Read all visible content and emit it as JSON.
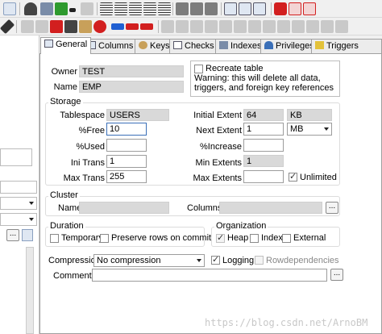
{
  "tabs": [
    {
      "label": "General",
      "icon": "general-tab-icon"
    },
    {
      "label": "Columns",
      "icon": "columns-tab-icon"
    },
    {
      "label": "Keys",
      "icon": "keys-tab-icon"
    },
    {
      "label": "Checks",
      "icon": "checks-tab-icon"
    },
    {
      "label": "Indexes",
      "icon": "indexes-tab-icon"
    },
    {
      "label": "Privileges",
      "icon": "privileges-tab-icon"
    },
    {
      "label": "Triggers",
      "icon": "triggers-tab-icon"
    }
  ],
  "general": {
    "owner_label": "Owner",
    "owner_value": "TEST",
    "name_label": "Name",
    "name_value": "EMP",
    "recreate_label": "Recreate table",
    "recreate_checked": false,
    "warning": "Warning: this will delete all data, triggers, and foreign key references"
  },
  "storage": {
    "title": "Storage",
    "tablespace_label": "Tablespace",
    "tablespace_value": "USERS",
    "pctfree_label": "%Free",
    "pctfree_value": "10",
    "pctused_label": "%Used",
    "pctused_value": "",
    "initrans_label": "Ini Trans",
    "initrans_value": "1",
    "maxtrans_label": "Max Trans",
    "maxtrans_value": "255",
    "initial_extent_label": "Initial Extent",
    "initial_extent_value": "64",
    "initial_extent_unit": "KB",
    "next_extent_label": "Next Extent",
    "next_extent_value": "1",
    "next_extent_unit": "MB",
    "pctincrease_label": "%Increase",
    "pctincrease_value": "",
    "min_extents_label": "Min Extents",
    "min_extents_value": "1",
    "max_extents_label": "Max Extents",
    "max_extents_value": "",
    "unlimited_label": "Unlimited",
    "unlimited_checked": true
  },
  "cluster": {
    "title": "Cluster",
    "name_label": "Name",
    "name_value": "",
    "columns_label": "Columns",
    "columns_value": "",
    "ellipsis": "..."
  },
  "duration": {
    "title": "Duration",
    "temporary_label": "Temporary",
    "preserve_label": "Preserve rows on commit"
  },
  "organization": {
    "title": "Organization",
    "heap_label": "Heap",
    "index_label": "Index",
    "external_label": "External",
    "heap_checked": true
  },
  "compression": {
    "label": "Compression",
    "value": "No compression"
  },
  "logging": {
    "label": "Logging",
    "checked": true,
    "rowdep_label": "Rowdependencies"
  },
  "comments": {
    "label": "Comments",
    "value": "",
    "ellipsis": "..."
  },
  "left_pane": {
    "ellipsis": "..."
  },
  "watermark": "https://blog.csdn.net/ArnoBM",
  "colors": {
    "accent_red": "#d21f1f",
    "accent_blue": "#1f5fd2",
    "accent_green": "#2e9a2e",
    "readonly_bg": "#d9d9d9"
  }
}
